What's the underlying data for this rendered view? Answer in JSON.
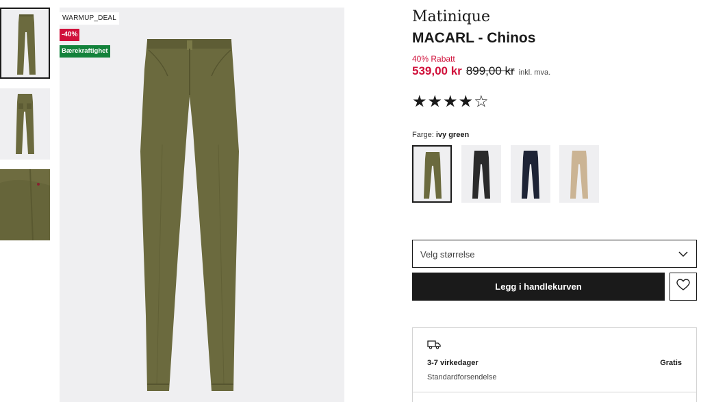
{
  "gallery": {
    "thumbnails": [
      {
        "label": "thumbnail-front"
      },
      {
        "label": "thumbnail-back"
      },
      {
        "label": "thumbnail-detail"
      }
    ],
    "flags": {
      "warmup": "WARMUP_DEAL",
      "discount": "-40%",
      "sustainability": "Bærekraftighet"
    }
  },
  "product": {
    "brand": "Matinique",
    "name": "MACARL - Chinos",
    "discount_text": "40% Rabatt",
    "price_now": "539,00 kr",
    "price_old": "899,00 kr",
    "price_note": "inkl. mva.",
    "rating": {
      "filled": 4,
      "total": 5,
      "stars_text": "★★★★☆"
    },
    "color_label": "Farge:",
    "color_value": "ivy green",
    "colors": [
      {
        "name": "ivy green",
        "hex": "#6b6a3e",
        "selected": true
      },
      {
        "name": "black",
        "hex": "#2b2b2b",
        "selected": false
      },
      {
        "name": "navy",
        "hex": "#1e2436",
        "selected": false
      },
      {
        "name": "beige",
        "hex": "#cbb494",
        "selected": false
      }
    ]
  },
  "actions": {
    "size_placeholder": "Velg størrelse",
    "add_to_cart": "Legg i handlekurven",
    "wishlist_icon": "heart-icon"
  },
  "delivery": {
    "icon": "truck-icon",
    "days": "3-7 virkedager",
    "price": "Gratis",
    "method": "Standardforsendelse"
  },
  "colors": {
    "sale_red": "#d0103a",
    "sustain_green": "#13823b",
    "button_black": "#1a1a1a",
    "image_bg": "#efeff1"
  }
}
